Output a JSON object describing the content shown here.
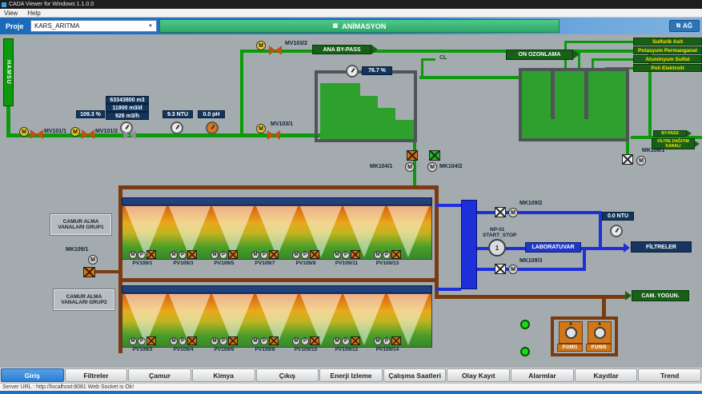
{
  "window": {
    "title": "CADA Viewer for Windows 1.1.0.0"
  },
  "menu": {
    "view": "View",
    "help": "Help"
  },
  "toolbar": {
    "proje": "Proje",
    "project": "KARS_ARITMA",
    "animasyon": "ANİMASYON",
    "ag": "AĞ"
  },
  "icons": {
    "animasyon": "▦",
    "ag": "⧉",
    "combo_arrow": "▼"
  },
  "sym": {
    "m": "M",
    "p": "P",
    "a": "A",
    "one": "1"
  },
  "scada": {
    "hamsu": "HAMSU",
    "labels": {
      "ana_bypass": "ANA BY-PASS",
      "on_ozonlama": "ON OZONLAMA",
      "cl": "CL",
      "bypass": "BY-PASS",
      "filtre_dagitim": "FİLTRE DAĞITIM KANALI",
      "laboratuvar": "LABORATUVAR",
      "filtreler": "FİLTRELER",
      "cam_yogun": "CAM. YOGUN.",
      "camur1": "CAMUR ALMA VANALARI GRUP1",
      "camur2": "CAMUR ALMA VANALARI GRUP2",
      "np01": "NP-01",
      "start_stop": "START_STOP"
    },
    "chemicals": [
      "Sulfurik Asit",
      "Potasyum Permanganat",
      "Aluminyum Sulfat",
      "Poli Elektrolit"
    ],
    "indicators": {
      "total": "63343800 m3",
      "daily": "11900 m3/d",
      "hourly": "926 m3/h",
      "percent": "109.3 %",
      "ntu_in": "9.3 NTU",
      "ph_in": "0.0 pH",
      "level": "76.7 %",
      "ntu_out": "0.0 NTU"
    },
    "valves": {
      "mv101_1": "MV101/1",
      "mv101_2": "MV101/2",
      "mv103_1": "MV103/1",
      "mv103_2": "MV103/2",
      "mk104_1": "MK104/1",
      "mk104_2": "MK104/2",
      "mk108_1": "MK108/1",
      "mk109_1": "MK109/1",
      "mk109_2": "MK109/2",
      "mk109_3": "MK109/3"
    },
    "pv_top": [
      "PV109/1",
      "PV109/3",
      "PV109/5",
      "PV109/7",
      "PV109/9",
      "PV109/11",
      "PV109/13"
    ],
    "pv_bottom": [
      "PV109/2",
      "PV109/4",
      "PV109/6",
      "PV109/8",
      "PV109/10",
      "PV109/12",
      "PV109/14"
    ],
    "pumps": [
      "P109/1",
      "P109/5"
    ]
  },
  "tabs": [
    "Giriş",
    "Filtreler",
    "Çamur",
    "Kimya",
    "Çıkış",
    "Enerji Izleme",
    "Çalışma Saatleri",
    "Olay Kayıt",
    "Alarmlar",
    "Kayıtlar",
    "Trend"
  ],
  "statusbar": {
    "text": "Server URL : http://localhost:8081 Web Socket is Ok!"
  }
}
